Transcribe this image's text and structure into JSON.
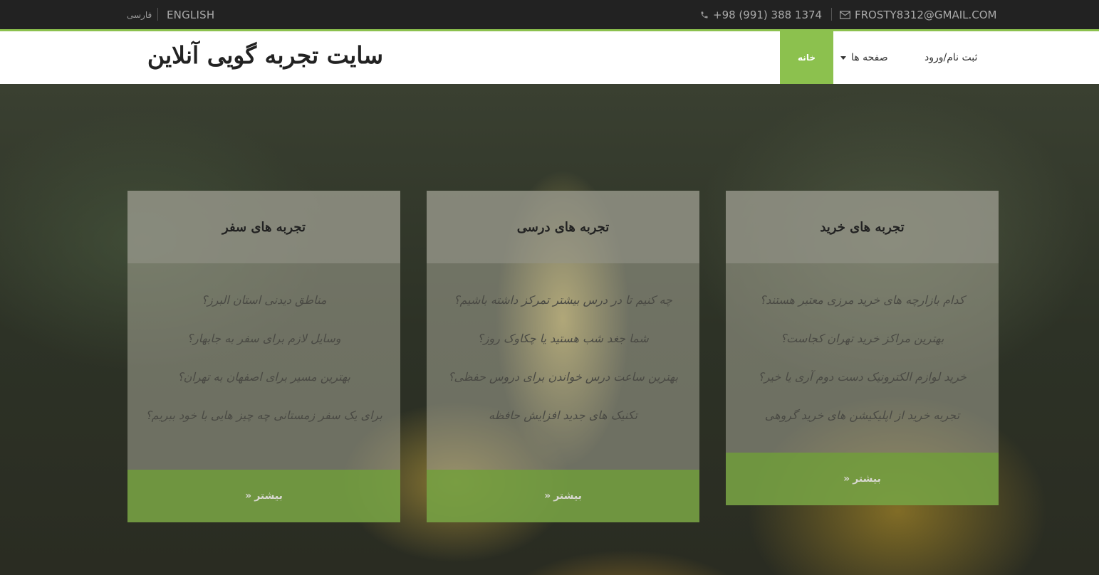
{
  "topbar": {
    "lang_fa": "فارسی",
    "lang_en": "ENGLISH",
    "phone": "+98 (991) 388 1374",
    "email": "FROSTY8312@GMAIL.COM",
    "phone_icon": "phone-icon",
    "email_icon": "envelope-icon"
  },
  "header": {
    "site_title": "سایت تجربه گویی آنلاین",
    "nav": {
      "home": "خانه",
      "pages": "صفحه ها",
      "login": "ثبت نام/ورود"
    }
  },
  "colors": {
    "accent": "#8cc14e",
    "topbar_bg": "#222222"
  },
  "cards": [
    {
      "title": "تجربه های سفر",
      "items": [
        "مناطق دیدنی استان البرز؟",
        "وسایل لازم برای سفر به جابهار؟",
        "بهترین مسیر برای اصفهان به تهران؟",
        "برای یک سفر زمستانی چه چیز هایی با خود ببریم؟"
      ],
      "more": "بیشتر"
    },
    {
      "title": "تجربه های درسی",
      "items": [
        "چه کنیم تا در درس بیشتر تمرکز داشته باشیم؟",
        "شما جغد شب هستید یا چکاوک روز؟",
        "بهترین ساعت درس خواندن برای دروس حفظی؟",
        "تکنیک های جدید افزایش حافظه"
      ],
      "more": "بیشتر"
    },
    {
      "title": "تجربه های خرید",
      "items": [
        "کدام بازارچه های خرید مرزی معتبر هستند؟",
        "بهترین مراکز خرید تهران کجاست؟",
        "خرید لوازم الکترونیک دست دوم آری یا خیر؟",
        "تجربه خرید از اپلیکیشن های خرید گروهی"
      ],
      "more": "بیشتر"
    }
  ]
}
